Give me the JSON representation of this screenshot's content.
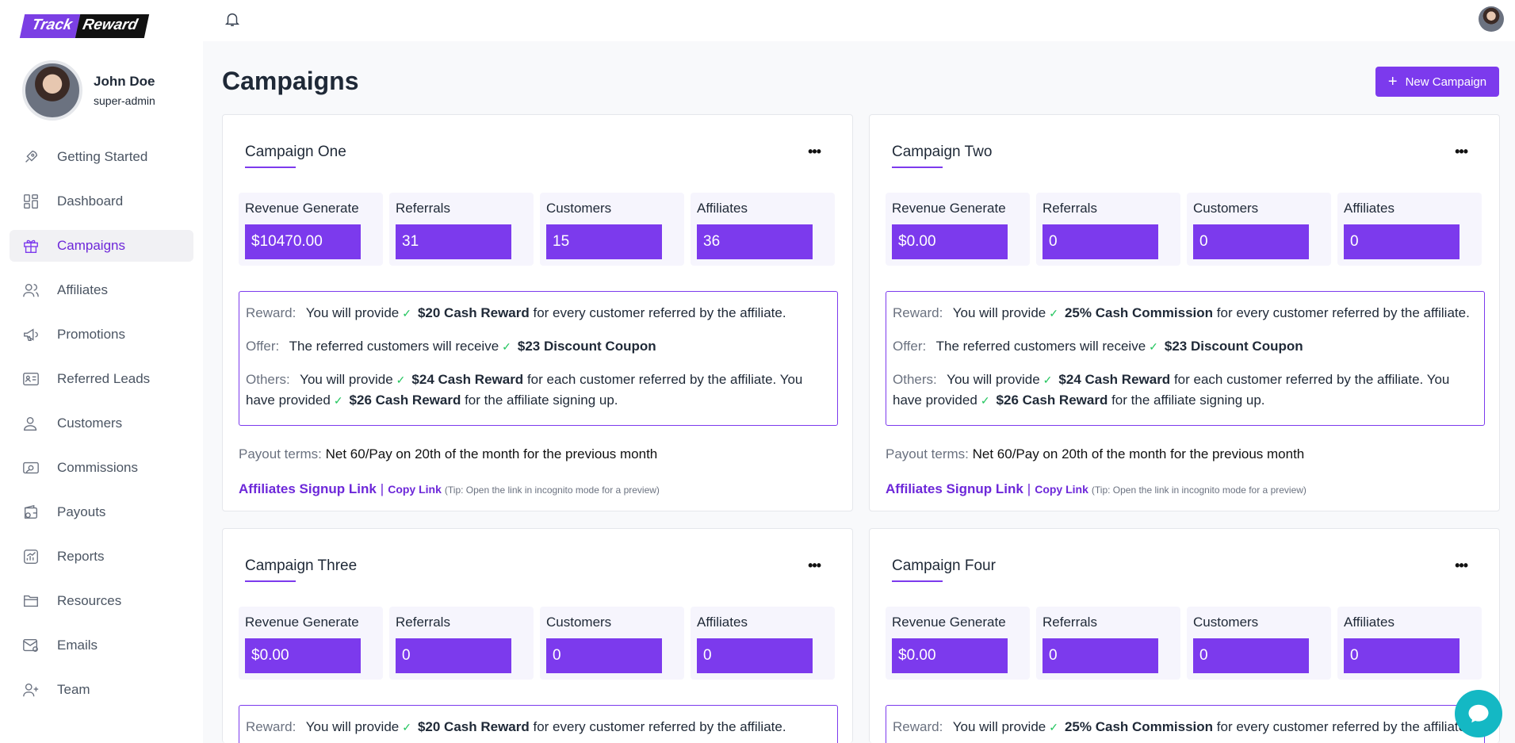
{
  "brand": {
    "part1": "Track",
    "part2": "Reward"
  },
  "user": {
    "name": "John Doe",
    "role": "super-admin"
  },
  "nav": [
    {
      "label": "Getting Started",
      "icon": "rocket-icon"
    },
    {
      "label": "Dashboard",
      "icon": "dashboard-icon"
    },
    {
      "label": "Campaigns",
      "icon": "gift-icon",
      "active": true
    },
    {
      "label": "Affiliates",
      "icon": "users-icon"
    },
    {
      "label": "Promotions",
      "icon": "megaphone-icon"
    },
    {
      "label": "Referred Leads",
      "icon": "id-card-icon"
    },
    {
      "label": "Customers",
      "icon": "user-icon"
    },
    {
      "label": "Commissions",
      "icon": "cash-icon"
    },
    {
      "label": "Payouts",
      "icon": "wallet-icon"
    },
    {
      "label": "Reports",
      "icon": "chart-icon"
    },
    {
      "label": "Resources",
      "icon": "folder-icon"
    },
    {
      "label": "Emails",
      "icon": "mail-icon"
    },
    {
      "label": "Team",
      "icon": "user-plus-icon"
    }
  ],
  "page": {
    "title": "Campaigns",
    "new_button": "New Campaign"
  },
  "labels": {
    "revenue": "Revenue Generate",
    "referrals": "Referrals",
    "customers": "Customers",
    "affiliates": "Affiliates",
    "reward": "Reward:",
    "offer": "Offer:",
    "others": "Others:",
    "payout": "Payout terms:",
    "signup_link": "Affiliates Signup Link",
    "separator": "|",
    "copy_link": "Copy Link",
    "tip": "(Tip: Open the link in incognito mode for a preview)"
  },
  "campaigns": [
    {
      "title": "Campaign One",
      "revenue": "$10470.00",
      "referrals": "31",
      "customers": "15",
      "affiliates": "36",
      "reward_pre": "You will provide",
      "reward_value": "$20 Cash Reward",
      "reward_post": "for every customer referred by the affiliate.",
      "offer_pre": "The referred customers will receive",
      "offer_value": "$23 Discount Coupon",
      "others_pre": "You will provide",
      "others_value": "$24 Cash Reward",
      "others_mid": "for each customer referred by the affiliate.   You have provided",
      "others_value2": "$26 Cash Reward",
      "others_post": "for the affiliate signing up.",
      "payout": "Net 60/Pay on 20th of the month for the previous month"
    },
    {
      "title": "Campaign Two",
      "revenue": "$0.00",
      "referrals": "0",
      "customers": "0",
      "affiliates": "0",
      "reward_pre": "You will provide",
      "reward_value": "25% Cash Commission",
      "reward_post": "for every customer referred by the affiliate.",
      "offer_pre": "The referred customers will receive",
      "offer_value": "$23 Discount Coupon",
      "others_pre": "You will provide",
      "others_value": "$24 Cash Reward",
      "others_mid": "for each customer referred by the affiliate.   You have provided",
      "others_value2": "$26 Cash Reward",
      "others_post": "for the affiliate signing up.",
      "payout": "Net 60/Pay on 20th of the month for the previous month"
    },
    {
      "title": "Campaign Three",
      "revenue": "$0.00",
      "referrals": "0",
      "customers": "0",
      "affiliates": "0",
      "reward_pre": "You will provide",
      "reward_value": "$20 Cash Reward",
      "reward_post": "for every customer referred by the affiliate."
    },
    {
      "title": "Campaign Four",
      "revenue": "$0.00",
      "referrals": "0",
      "customers": "0",
      "affiliates": "0",
      "reward_pre": "You will provide",
      "reward_value": "25% Cash Commission",
      "reward_post": "for every customer referred by the affiliate."
    }
  ],
  "colors": {
    "accent": "#7c3aed",
    "check": "#22c55e",
    "chat": "#14b8c4"
  }
}
